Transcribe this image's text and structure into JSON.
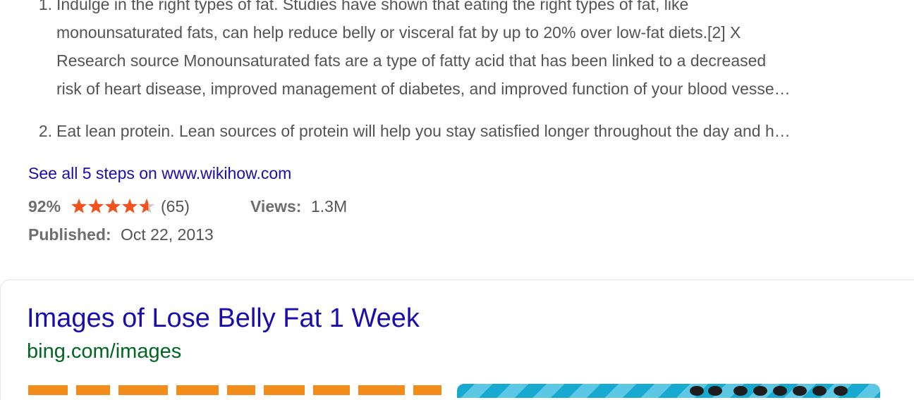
{
  "steps": [
    {
      "number": "1.",
      "lines": [
        "Indulge in the right types of fat. Studies have shown that eating the right types of fat, like",
        "monounsaturated fats, can help reduce belly or visceral fat by up to 20% over low-fat diets.[2] X",
        "Research source Monounsaturated fats are a type of fatty acid that has been linked to a decreased",
        "risk of heart disease, improved management of diabetes, and improved function of your blood vesse…"
      ]
    },
    {
      "number": "2.",
      "lines": [
        "Eat lean protein. Lean sources of protein will help you stay satisfied longer throughout the day and h…"
      ]
    }
  ],
  "see_all_link": "See all 5 steps on www.wikihow.com",
  "rating": {
    "percent": "92%",
    "stars_value": 4.6,
    "stars_max": 5,
    "count": "(65)",
    "star_color": "#f4511e",
    "star_empty_color": "#cccccc"
  },
  "views": {
    "label": "Views:",
    "value": "1.3M"
  },
  "published": {
    "label": "Published:",
    "value": "Oct 22, 2013"
  },
  "images_result": {
    "title": "Images of Lose Belly Fat 1 Week",
    "url": "bing.com/images"
  },
  "colors": {
    "link": "#1a0dab",
    "url_green": "#006621",
    "body_text": "#545454"
  }
}
